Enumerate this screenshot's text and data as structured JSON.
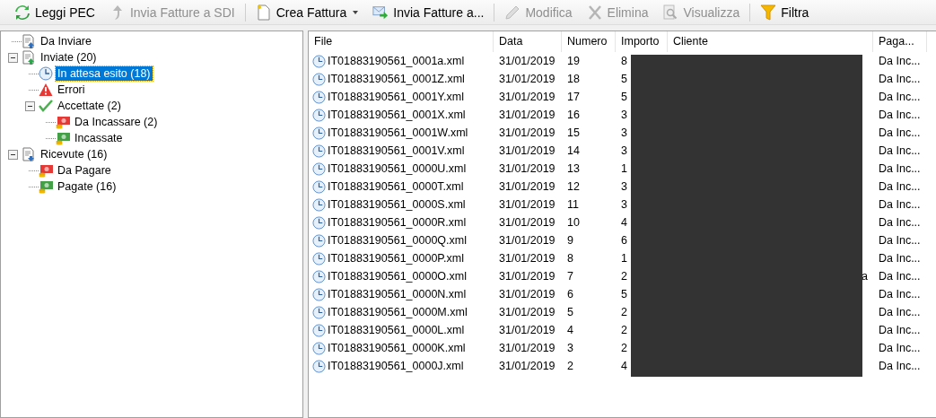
{
  "toolbar": [
    [
      {
        "label": "Leggi PEC",
        "kind": "refresh",
        "disabled": false,
        "dropdown": false
      },
      {
        "label": "Invia Fatture a SDI",
        "kind": "upload",
        "disabled": true,
        "dropdown": false
      }
    ],
    [
      {
        "label": "Crea Fattura",
        "kind": "new",
        "disabled": false,
        "dropdown": true
      },
      {
        "label": "Invia Fatture a...",
        "kind": "mail",
        "disabled": false,
        "dropdown": false
      }
    ],
    [
      {
        "label": "Modifica",
        "kind": "pencil",
        "disabled": true,
        "dropdown": false
      },
      {
        "label": "Elimina",
        "kind": "delete",
        "disabled": true,
        "dropdown": false
      },
      {
        "label": "Visualizza",
        "kind": "view",
        "disabled": true,
        "dropdown": false
      }
    ],
    [
      {
        "label": "Filtra",
        "kind": "filter",
        "disabled": false,
        "dropdown": false
      }
    ]
  ],
  "tree": [
    {
      "label": "Da Inviare",
      "kind": "doc-up",
      "selected": false
    },
    {
      "label": "Inviate (20)",
      "kind": "doc-sent",
      "selected": false,
      "expanded": true,
      "children": [
        {
          "label": "In attesa esito (18)",
          "kind": "clock",
          "selected": true
        },
        {
          "label": "Errori",
          "kind": "warning",
          "selected": false
        },
        {
          "label": "Accettate (2)",
          "kind": "check",
          "selected": false,
          "expanded": true,
          "children": [
            {
              "label": "Da Incassare (2)",
              "kind": "money-red",
              "selected": false
            },
            {
              "label": "Incassate",
              "kind": "money-green",
              "selected": false
            }
          ]
        }
      ]
    },
    {
      "label": "Ricevute (16)",
      "kind": "doc-down",
      "selected": false,
      "expanded": true,
      "children": [
        {
          "label": "Da Pagare",
          "kind": "money-red",
          "selected": false
        },
        {
          "label": "Pagate (16)",
          "kind": "money-green",
          "selected": false
        }
      ]
    }
  ],
  "table": {
    "columns": [
      "File",
      "Data",
      "Numero",
      "Importo",
      "Cliente",
      "Paga..."
    ],
    "rows": [
      {
        "file": "IT01883190561_0001a.xml",
        "data": "31/01/2019",
        "numero": "19",
        "importo": "8",
        "pagamento": "Da Inc..."
      },
      {
        "file": "IT01883190561_0001Z.xml",
        "data": "31/01/2019",
        "numero": "18",
        "importo": "5",
        "pagamento": "Da Inc..."
      },
      {
        "file": "IT01883190561_0001Y.xml",
        "data": "31/01/2019",
        "numero": "17",
        "importo": "5",
        "pagamento": "Da Inc..."
      },
      {
        "file": "IT01883190561_0001X.xml",
        "data": "31/01/2019",
        "numero": "16",
        "importo": "3",
        "pagamento": "Da Inc..."
      },
      {
        "file": "IT01883190561_0001W.xml",
        "data": "31/01/2019",
        "numero": "15",
        "importo": "3",
        "pagamento": "Da Inc..."
      },
      {
        "file": "IT01883190561_0001V.xml",
        "data": "31/01/2019",
        "numero": "14",
        "importo": "3",
        "pagamento": "Da Inc..."
      },
      {
        "file": "IT01883190561_0000U.xml",
        "data": "31/01/2019",
        "numero": "13",
        "importo": "1",
        "pagamento": "Da Inc..."
      },
      {
        "file": "IT01883190561_0000T.xml",
        "data": "31/01/2019",
        "numero": "12",
        "importo": "3",
        "pagamento": "Da Inc..."
      },
      {
        "file": "IT01883190561_0000S.xml",
        "data": "31/01/2019",
        "numero": "11",
        "importo": "3",
        "pagamento": "Da Inc..."
      },
      {
        "file": "IT01883190561_0000R.xml",
        "data": "31/01/2019",
        "numero": "10",
        "importo": "4",
        "pagamento": "Da Inc..."
      },
      {
        "file": "IT01883190561_0000Q.xml",
        "data": "31/01/2019",
        "numero": "9",
        "importo": "6",
        "pagamento": "Da Inc..."
      },
      {
        "file": "IT01883190561_0000P.xml",
        "data": "31/01/2019",
        "numero": "8",
        "importo": "1",
        "pagamento": "Da Inc..."
      },
      {
        "file": "IT01883190561_0000O.xml",
        "data": "31/01/2019",
        "numero": "7",
        "importo": "2",
        "cliente": "a",
        "pagamento": "Da Inc..."
      },
      {
        "file": "IT01883190561_0000N.xml",
        "data": "31/01/2019",
        "numero": "6",
        "importo": "5",
        "pagamento": "Da Inc..."
      },
      {
        "file": "IT01883190561_0000M.xml",
        "data": "31/01/2019",
        "numero": "5",
        "importo": "2",
        "pagamento": "Da Inc..."
      },
      {
        "file": "IT01883190561_0000L.xml",
        "data": "31/01/2019",
        "numero": "4",
        "importo": "2",
        "pagamento": "Da Inc..."
      },
      {
        "file": "IT01883190561_0000K.xml",
        "data": "31/01/2019",
        "numero": "3",
        "importo": "2",
        "pagamento": "Da Inc..."
      },
      {
        "file": "IT01883190561_0000J.xml",
        "data": "31/01/2019",
        "numero": "2",
        "importo": "4",
        "pagamento": "Da Inc..."
      }
    ]
  }
}
